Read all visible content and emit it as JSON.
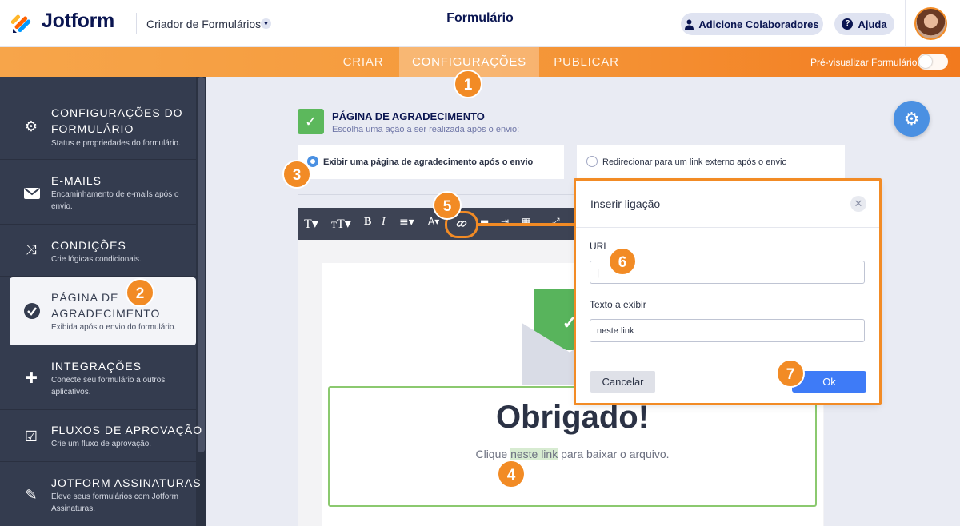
{
  "topbar": {
    "logo": "Jotform",
    "builder_label": "Criador de Formulários",
    "form_title": "Formulário",
    "collab_button": "Adicione Colaboradores",
    "help_button": "Ajuda"
  },
  "nav": {
    "tabs": [
      "CRIAR",
      "CONFIGURAÇÕES",
      "PUBLICAR"
    ],
    "active_tab": "CONFIGURAÇÕES",
    "preview_label": "Pré-visualizar Formulário"
  },
  "sidebar": {
    "items": [
      {
        "title_1": "CONFIGURAÇÕES DO",
        "title_2": "FORMULÁRIO",
        "desc": "Status e propriedades do formulário.",
        "icon": "gear-icon"
      },
      {
        "title": "E-MAILS",
        "desc": "Encaminhamento de e-mails após o envio.",
        "icon": "envelope-icon"
      },
      {
        "title": "CONDIÇÕES",
        "desc": "Crie lógicas condicionais.",
        "icon": "shuffle-icon"
      },
      {
        "title_1": "PÁGINA DE",
        "title_2": "AGRADECIMENTO",
        "desc": "Exibida após o envio do formulário.",
        "icon": "check-circle-icon",
        "active": true
      },
      {
        "title": "INTEGRAÇÕES",
        "desc": "Conecte seu formulário a outros aplicativos.",
        "icon": "puzzle-icon"
      },
      {
        "title": "FLUXOS DE APROVAÇÃO",
        "desc": "Crie um fluxo de aprovação.",
        "icon": "approval-icon"
      },
      {
        "title": "JOTFORM ASSINATURAS",
        "desc": "Eleve seus formulários com Jotform Assinaturas.",
        "icon": "pen-icon"
      }
    ]
  },
  "main": {
    "title": "PÁGINA DE AGRADECIMENTO",
    "subtitle": "Escolha uma ação a ser realizada após o envio:",
    "option_1": "Exibir uma página de agradecimento após o envio",
    "option_2": "Redirecionar para um link externo após o envio",
    "selected_option": 1
  },
  "editor": {
    "heading": "Obrigado!",
    "line_before": "Clique ",
    "link_text": "neste link",
    "line_after": " para baixar o arquivo."
  },
  "modal": {
    "title": "Inserir ligação",
    "url_label": "URL",
    "url_value": "|",
    "text_label": "Texto a exibir",
    "text_value": "neste link",
    "cancel": "Cancelar",
    "ok": "Ok"
  },
  "markers": [
    "1",
    "2",
    "3",
    "4",
    "5",
    "6",
    "7"
  ],
  "colors": {
    "accent_orange": "#f28b25",
    "sidebar_bg": "#343c4f",
    "ok_blue": "#3e7bf7",
    "success_green": "#5cb85c"
  }
}
